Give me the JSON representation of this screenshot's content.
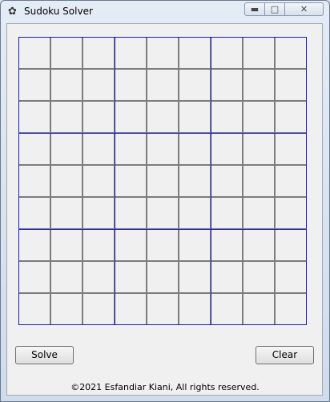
{
  "window": {
    "title": "Sudoku Solver",
    "icon": "feather-icon"
  },
  "controls": {
    "minimize_icon": "minimize-icon",
    "maximize_icon": "maximize-icon",
    "close_icon": "close-icon"
  },
  "board": {
    "rows": 9,
    "cols": 9,
    "cells": [
      [
        "",
        "",
        "",
        "",
        "",
        "",
        "",
        "",
        ""
      ],
      [
        "",
        "",
        "",
        "",
        "",
        "",
        "",
        "",
        ""
      ],
      [
        "",
        "",
        "",
        "",
        "",
        "",
        "",
        "",
        ""
      ],
      [
        "",
        "",
        "",
        "",
        "",
        "",
        "",
        "",
        ""
      ],
      [
        "",
        "",
        "",
        "",
        "",
        "",
        "",
        "",
        ""
      ],
      [
        "",
        "",
        "",
        "",
        "",
        "",
        "",
        "",
        ""
      ],
      [
        "",
        "",
        "",
        "",
        "",
        "",
        "",
        "",
        ""
      ],
      [
        "",
        "",
        "",
        "",
        "",
        "",
        "",
        "",
        ""
      ],
      [
        "",
        "",
        "",
        "",
        "",
        "",
        "",
        "",
        ""
      ]
    ],
    "block_line_color": "#1a1ac8",
    "cell_border_color": "#7c7c7c"
  },
  "buttons": {
    "solve_label": "Solve",
    "clear_label": "Clear"
  },
  "footer": {
    "text": "©2021 Esfandiar Kiani, All rights reserved."
  }
}
